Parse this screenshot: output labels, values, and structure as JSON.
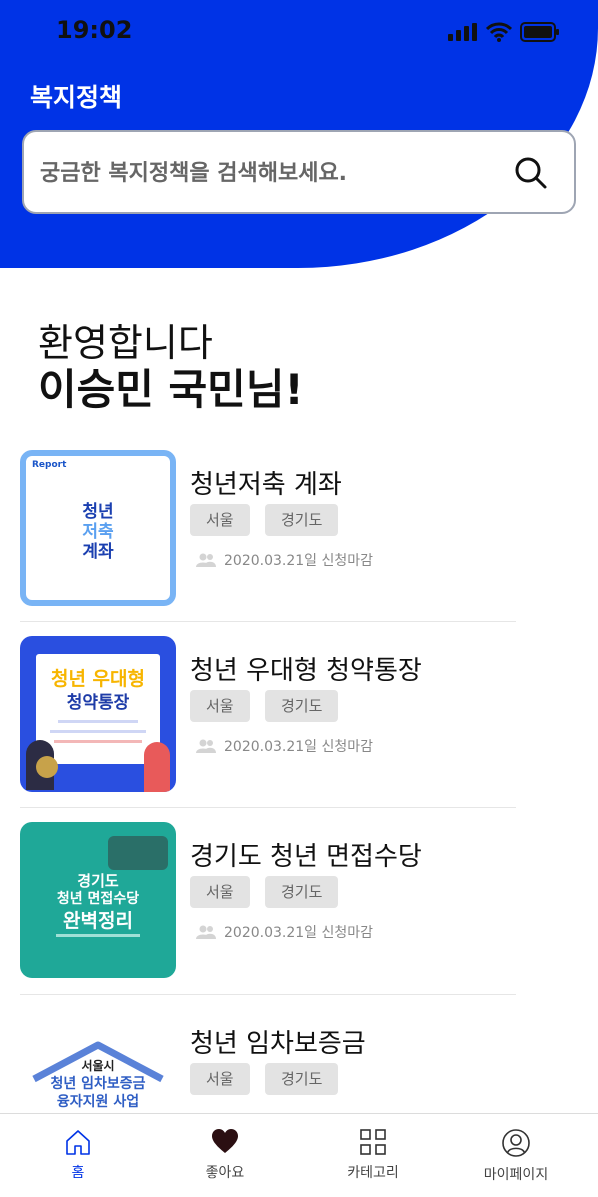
{
  "status_bar": {
    "time": "19:02"
  },
  "header": {
    "title": "복지정책"
  },
  "search": {
    "placeholder": "궁금한 복지정책을 검색해보세요."
  },
  "welcome": {
    "line1": "환영합니다",
    "line2": "이승민 국민님!"
  },
  "policies": [
    {
      "title": "청년저축 계좌",
      "tags": [
        "서울",
        "경기도"
      ],
      "deadline": "2020.03.21일 신청마감",
      "thumb_text": [
        "청년",
        "저축",
        "계좌"
      ],
      "thumb_brand": "Report"
    },
    {
      "title": "청년 우대형 청약통장",
      "tags": [
        "서울",
        "경기도"
      ],
      "deadline": "2020.03.21일 신청마감",
      "thumb_text": [
        "청년 우대형",
        "청약통장"
      ]
    },
    {
      "title": "경기도 청년 면접수당",
      "tags": [
        "서울",
        "경기도"
      ],
      "deadline": "2020.03.21일 신청마감",
      "thumb_text": [
        "경기도",
        "청년 면접수당",
        "완벽정리"
      ]
    },
    {
      "title": "청년 임차보증금",
      "tags": [
        "서울",
        "경기도"
      ],
      "deadline": "",
      "thumb_text": [
        "서울시",
        "청년 임차보증금",
        "융자지원 사업"
      ]
    }
  ],
  "tabs": [
    {
      "label": "홈",
      "icon": "home-icon"
    },
    {
      "label": "좋아요",
      "icon": "heart-icon"
    },
    {
      "label": "카테고리",
      "icon": "grid-icon"
    },
    {
      "label": "마이페이지",
      "icon": "user-icon"
    }
  ],
  "colors": {
    "primary": "#0033e6",
    "tag_bg": "#e3e3e3"
  }
}
